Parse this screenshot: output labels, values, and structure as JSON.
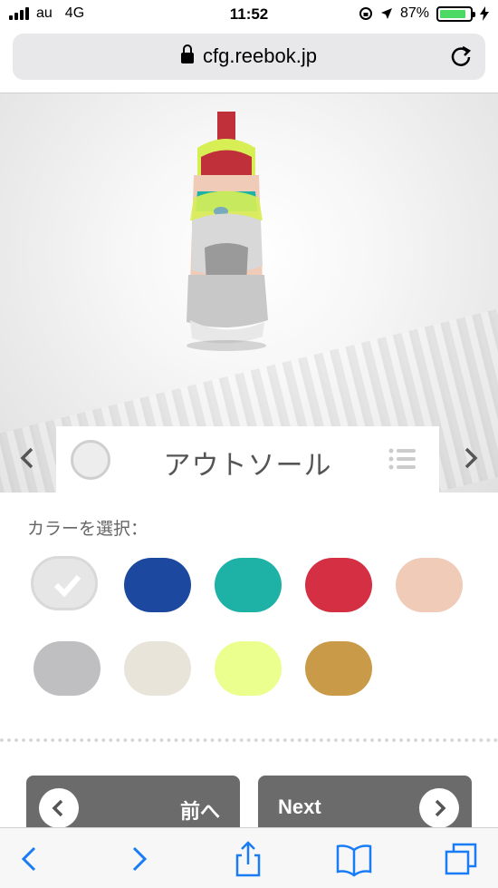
{
  "status": {
    "carrier": "au",
    "network": "4G",
    "time": "11:52",
    "battery": "87%"
  },
  "browser": {
    "url": "cfg.reebok.jp"
  },
  "part": {
    "title": "アウトソール"
  },
  "colors": {
    "label": "カラーを選択：",
    "swatches": [
      {
        "name": "white",
        "hex": "#e6e6e6",
        "selected": true
      },
      {
        "name": "blue",
        "hex": "#1c489f"
      },
      {
        "name": "teal",
        "hex": "#1eb2a6"
      },
      {
        "name": "red",
        "hex": "#d42f43"
      },
      {
        "name": "peach",
        "hex": "#efcbb8"
      },
      {
        "name": "gray",
        "hex": "#bfbfc1"
      },
      {
        "name": "cream",
        "hex": "#e8e4d9"
      },
      {
        "name": "lime",
        "hex": "#eaff8e"
      },
      {
        "name": "gold",
        "hex": "#c99b48"
      }
    ]
  },
  "buttons": {
    "prev": "前へ",
    "next": "Next"
  }
}
